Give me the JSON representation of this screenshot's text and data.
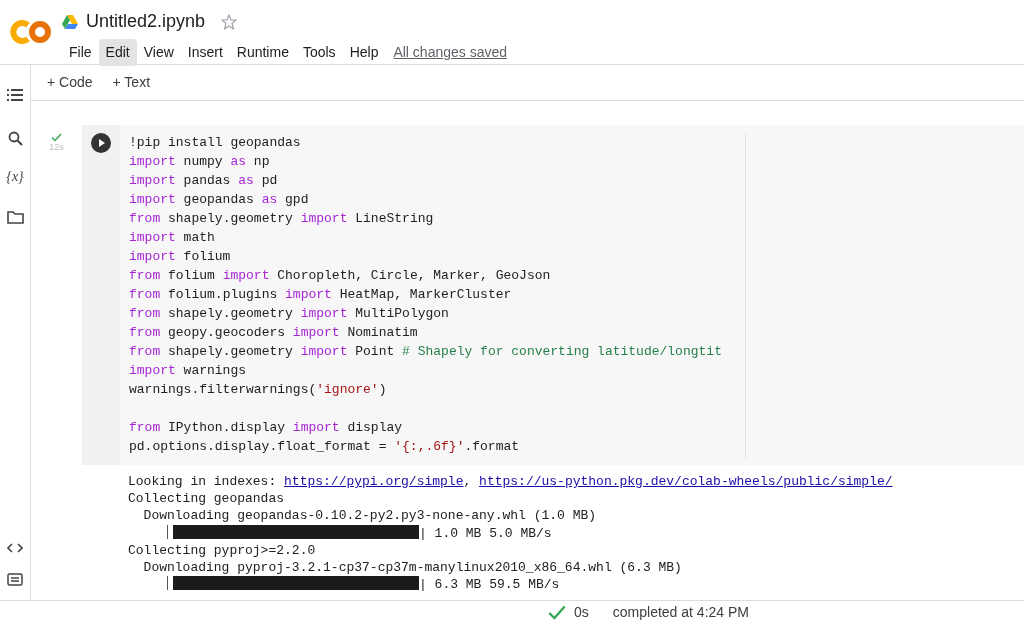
{
  "header": {
    "title": "Untitled2.ipynb",
    "starred": false,
    "menu": [
      {
        "label": "File",
        "selected": false
      },
      {
        "label": "Edit",
        "selected": true
      },
      {
        "label": "View",
        "selected": false
      },
      {
        "label": "Insert",
        "selected": false
      },
      {
        "label": "Runtime",
        "selected": false
      },
      {
        "label": "Tools",
        "selected": false
      },
      {
        "label": "Help",
        "selected": false
      }
    ],
    "save_status": "All changes saved"
  },
  "toolbar": [
    {
      "icon": "+",
      "label": "Code"
    },
    {
      "icon": "+",
      "label": "Text"
    }
  ],
  "sidebar": {
    "variable_icon": "{x}"
  },
  "cell": {
    "run_time": "12s",
    "code": [
      [
        {
          "kind": "plain",
          "text": "!pip install geopandas"
        }
      ],
      [
        {
          "kind": "keyword",
          "text": "import"
        },
        {
          "kind": "plain",
          "text": " numpy "
        },
        {
          "kind": "keyword",
          "text": "as"
        },
        {
          "kind": "plain",
          "text": " np"
        }
      ],
      [
        {
          "kind": "keyword",
          "text": "import"
        },
        {
          "kind": "plain",
          "text": " pandas "
        },
        {
          "kind": "keyword",
          "text": "as"
        },
        {
          "kind": "plain",
          "text": " pd"
        }
      ],
      [
        {
          "kind": "keyword",
          "text": "import"
        },
        {
          "kind": "plain",
          "text": " geopandas "
        },
        {
          "kind": "keyword",
          "text": "as"
        },
        {
          "kind": "plain",
          "text": " gpd"
        }
      ],
      [
        {
          "kind": "keyword",
          "text": "from"
        },
        {
          "kind": "plain",
          "text": " shapely.geometry "
        },
        {
          "kind": "keyword",
          "text": "import"
        },
        {
          "kind": "plain",
          "text": " LineString"
        }
      ],
      [
        {
          "kind": "keyword",
          "text": "import"
        },
        {
          "kind": "plain",
          "text": " math"
        }
      ],
      [
        {
          "kind": "keyword",
          "text": "import"
        },
        {
          "kind": "plain",
          "text": " folium"
        }
      ],
      [
        {
          "kind": "keyword",
          "text": "from"
        },
        {
          "kind": "plain",
          "text": " folium "
        },
        {
          "kind": "keyword",
          "text": "import"
        },
        {
          "kind": "plain",
          "text": " Choropleth, Circle, Marker, GeoJson"
        }
      ],
      [
        {
          "kind": "keyword",
          "text": "from"
        },
        {
          "kind": "plain",
          "text": " folium.plugins "
        },
        {
          "kind": "keyword",
          "text": "import"
        },
        {
          "kind": "plain",
          "text": " HeatMap, MarkerCluster"
        }
      ],
      [
        {
          "kind": "keyword",
          "text": "from"
        },
        {
          "kind": "plain",
          "text": " shapely.geometry "
        },
        {
          "kind": "keyword",
          "text": "import"
        },
        {
          "kind": "plain",
          "text": " MultiPolygon"
        }
      ],
      [
        {
          "kind": "keyword",
          "text": "from"
        },
        {
          "kind": "plain",
          "text": " geopy.geocoders "
        },
        {
          "kind": "keyword",
          "text": "import"
        },
        {
          "kind": "plain",
          "text": " Nominatim"
        }
      ],
      [
        {
          "kind": "keyword",
          "text": "from"
        },
        {
          "kind": "plain",
          "text": " shapely.geometry "
        },
        {
          "kind": "keyword",
          "text": "import"
        },
        {
          "kind": "plain",
          "text": " Point "
        },
        {
          "kind": "comment",
          "text": "# Shapely for converting latitude/longtit"
        }
      ],
      [
        {
          "kind": "keyword",
          "text": "import"
        },
        {
          "kind": "plain",
          "text": " warnings"
        }
      ],
      [
        {
          "kind": "plain",
          "text": "warnings.filterwarnings("
        },
        {
          "kind": "string",
          "text": "'ignore'"
        },
        {
          "kind": "plain",
          "text": ")"
        }
      ],
      {
        "kind": "blank"
      },
      [
        {
          "kind": "keyword",
          "text": "from"
        },
        {
          "kind": "plain",
          "text": " IPython.display "
        },
        {
          "kind": "keyword",
          "text": "import"
        },
        {
          "kind": "plain",
          "text": " display"
        }
      ],
      [
        {
          "kind": "plain",
          "text": "pd.options.display.float_format = "
        },
        {
          "kind": "string",
          "text": "'{:,.6f}'"
        },
        {
          "kind": "plain",
          "text": ".format"
        }
      ]
    ],
    "output": [
      {
        "kind": "text",
        "parts": [
          {
            "kind": "plain",
            "text": "Looking in indexes: "
          },
          {
            "kind": "link",
            "text": "https://pypi.org/simple"
          },
          {
            "kind": "plain",
            "text": ", "
          },
          {
            "kind": "link",
            "text": "https://us-python.pkg.dev/colab-wheels/public/simple/"
          }
        ]
      },
      {
        "kind": "text",
        "parts": [
          {
            "kind": "plain",
            "text": "Collecting geopandas"
          }
        ]
      },
      {
        "kind": "text",
        "parts": [
          {
            "kind": "plain",
            "text": "  Downloading geopandas-0.10.2-py2.py3-none-any.whl (1.0 MB)"
          }
        ]
      },
      {
        "kind": "progress",
        "level": 1.0,
        "reading": "| 1.0 MB 5.0 MB/s"
      },
      {
        "kind": "text",
        "parts": [
          {
            "kind": "plain",
            "text": "Collecting pyproj>=2.2.0"
          }
        ]
      },
      {
        "kind": "text",
        "parts": [
          {
            "kind": "plain",
            "text": "  Downloading pyproj-3.2.1-cp37-cp37m-manylinux2010_x86_64.whl (6.3 MB)"
          }
        ]
      },
      {
        "kind": "progress",
        "level": 1.0,
        "reading": "| 6.3 MB 59.5 MB/s"
      }
    ]
  },
  "status_bar": {
    "duration": "0s",
    "message": "completed at 4:24 PM"
  }
}
